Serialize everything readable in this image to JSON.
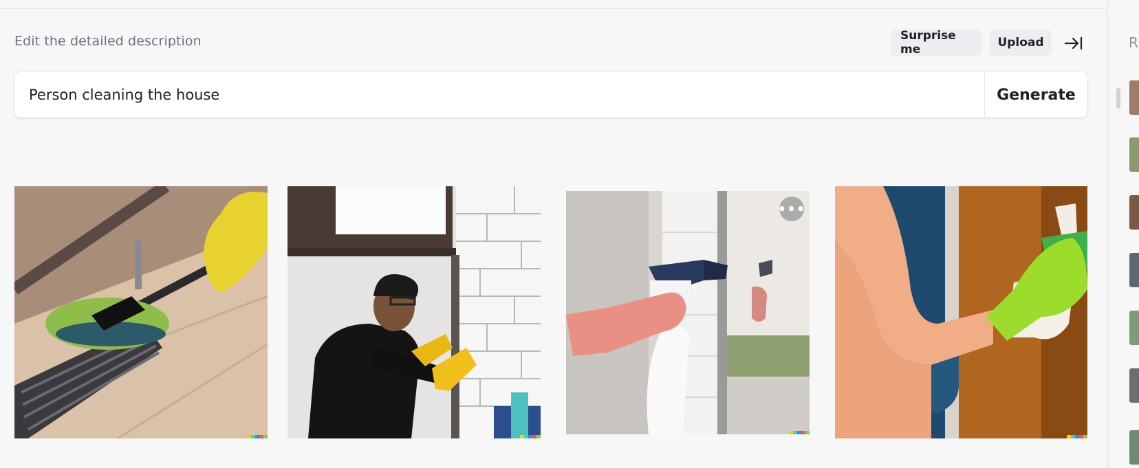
{
  "prompt": {
    "title": "Edit the detailed description",
    "value": "Person cleaning the house",
    "generate_label": "Generate"
  },
  "toolbar": {
    "surprise_label": "Surprise me",
    "upload_label": "Upload",
    "collapse_icon": "collapse-right-icon"
  },
  "results": [
    {
      "name": "Image of a mop cleaning a floor with a yellow gloved hand",
      "has_more_menu": false
    },
    {
      "name": "Image of a man cleaning a tiled wall with yellow gloves",
      "has_more_menu": false
    },
    {
      "name": "Image of a pink gloved hand holding a spray bottle near a window",
      "has_more_menu": true
    },
    {
      "name": "Image of a green gloved hand spraying a wooden door",
      "has_more_menu": false
    }
  ],
  "more_menu_label": "•••",
  "signature_colors": [
    "#f5d000",
    "#41d3bd",
    "#3a86ff",
    "#ff4f4f",
    "#7bd64a"
  ],
  "sidebar": {
    "title": "R"
  },
  "colors": {
    "background": "#f7f7f8",
    "pill": "#ececf1",
    "text": "#202123",
    "muted": "#6e6e80"
  }
}
